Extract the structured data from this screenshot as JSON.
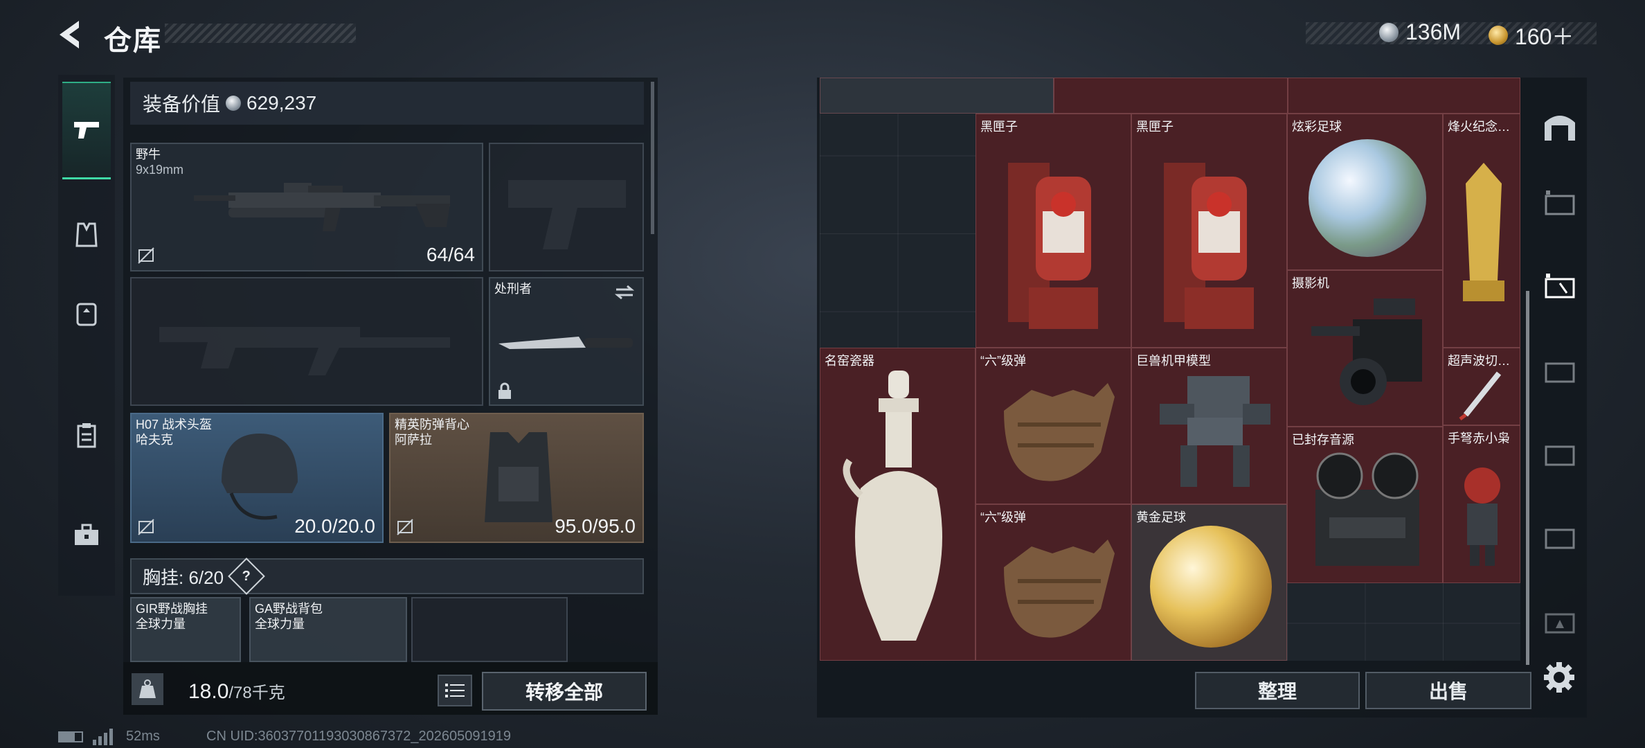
{
  "header": {
    "title": "仓库"
  },
  "currency": {
    "silver": "136M",
    "gold": "160＋"
  },
  "loadout": {
    "value_label": "装备价值",
    "value": "629,237",
    "primary": {
      "name": "野牛",
      "ammo": "9x19mm",
      "durability": "64/64"
    },
    "melee": {
      "name": "处刑者"
    },
    "helmet": {
      "name": "H07 战术头盔",
      "maker": "哈夫克",
      "durability": "20.0/20.0"
    },
    "armor": {
      "name": "精英防弹背心",
      "maker": "阿萨拉",
      "durability": "95.0/95.0"
    },
    "chest_label": "胸挂:",
    "chest_count": "6/20",
    "chest_help": "?",
    "rig": {
      "name": "GIR野战胸挂",
      "maker": "全球力量"
    },
    "backpack": {
      "name": "GA野战背包",
      "maker": "全球力量"
    }
  },
  "weight": {
    "current": "18.0",
    "max": "/78千克"
  },
  "actions": {
    "transfer_all": "转移全部",
    "sort": "整理",
    "sell": "出售"
  },
  "stash_items": [
    {
      "name": "黑匣子"
    },
    {
      "name": "黑匣子"
    },
    {
      "name": "炫彩足球"
    },
    {
      "name": "烽火纪念…"
    },
    {
      "name": "摄影机"
    },
    {
      "name": "名窑瓷器"
    },
    {
      "name": "“六”级弹"
    },
    {
      "name": "巨兽机甲模型"
    },
    {
      "name": "超声波切…"
    },
    {
      "name": "已封存音源"
    },
    {
      "name": "手弩赤小枭"
    },
    {
      "name": "“六”级弹"
    },
    {
      "name": "黄金足球"
    }
  ],
  "status": {
    "ping": "52ms",
    "uid": "CN UID:360377011930308673​72_202605091919"
  },
  "colors": {
    "accent": "#3fd9a6",
    "item_bg": "#4a2025",
    "helmet_bg": "#3d5b78",
    "armor_bg": "#5f5043"
  }
}
